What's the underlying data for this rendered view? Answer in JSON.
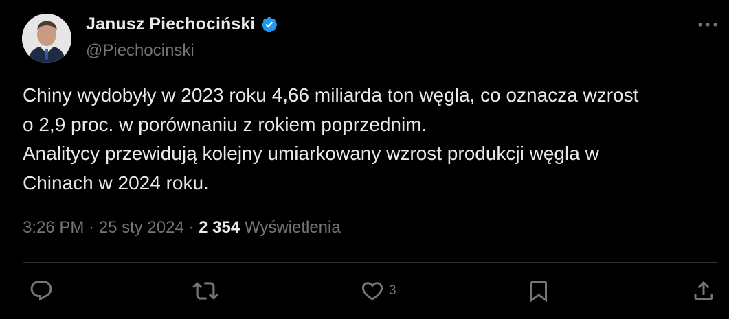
{
  "author": {
    "name": "Janusz Piechociński",
    "handle": "@Piechocinski",
    "verified": true,
    "verified_color": "#1d9bf0"
  },
  "tweet": {
    "lines": [
      "Chiny wydobyły w 2023 roku 4,66 miliarda ton węgla, co oznacza wzrost",
      "o 2,9 proc. w porównaniu z rokiem poprzednim.",
      "Analitycy przewidują kolejny umiarkowany wzrost produkcji węgla w",
      "Chinach w 2024 roku."
    ]
  },
  "meta": {
    "time": "3:26 PM",
    "separator": " · ",
    "date": "25 sty 2024",
    "views_count": "2 354",
    "views_label": "Wyświetlenia"
  },
  "actions": {
    "reply": {
      "icon": "reply-icon",
      "count": ""
    },
    "retweet": {
      "icon": "retweet-icon",
      "count": ""
    },
    "like": {
      "icon": "heart-icon",
      "count": "3"
    },
    "bookmark": {
      "icon": "bookmark-icon",
      "count": ""
    },
    "share": {
      "icon": "share-icon",
      "count": ""
    }
  },
  "colors": {
    "background": "#000000",
    "text_primary": "#e7e9ea",
    "text_secondary": "#71767b",
    "divider": "#2f3336",
    "accent": "#1d9bf0"
  }
}
